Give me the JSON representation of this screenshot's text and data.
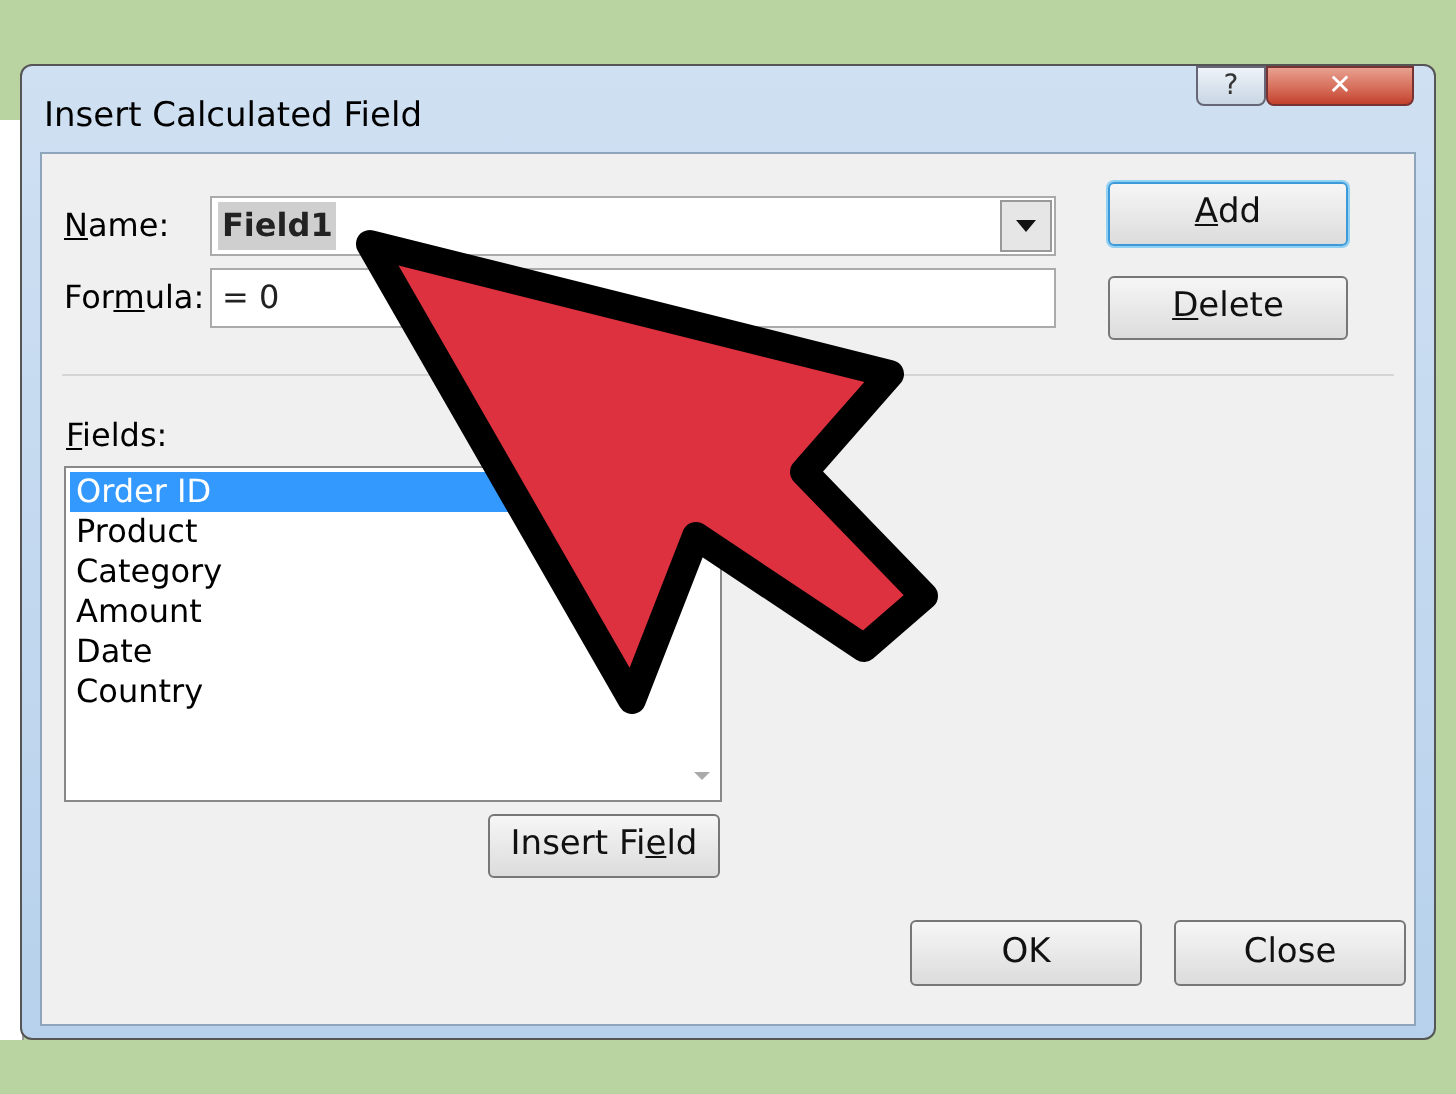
{
  "window": {
    "title": "Insert Calculated Field",
    "help": "?",
    "close": "✕"
  },
  "name_field": {
    "label": {
      "key": "N",
      "after": "ame:"
    },
    "value": "Field1"
  },
  "formula_field": {
    "label": {
      "before": "For",
      "key": "m",
      "after": "ula:"
    },
    "value": "= 0"
  },
  "side_buttons": [
    {
      "label": {
        "key": "A",
        "after": "dd"
      },
      "default": true
    },
    {
      "label": {
        "key": "D",
        "after": "elete"
      },
      "default": false
    }
  ],
  "fields": {
    "label": {
      "key": "F",
      "after": "ields:"
    },
    "items": [
      {
        "label": "Order ID",
        "selected": true
      },
      {
        "label": "Product",
        "selected": false
      },
      {
        "label": "Category",
        "selected": false
      },
      {
        "label": "Amount",
        "selected": false
      },
      {
        "label": "Date",
        "selected": false
      },
      {
        "label": "Country",
        "selected": false
      }
    ]
  },
  "insert_button": {
    "label": {
      "before": "Insert Fi",
      "key": "e",
      "after": "ld"
    }
  },
  "footer_buttons": [
    {
      "label": {
        "before": "OK"
      }
    },
    {
      "label": {
        "before": "Close"
      }
    }
  ]
}
